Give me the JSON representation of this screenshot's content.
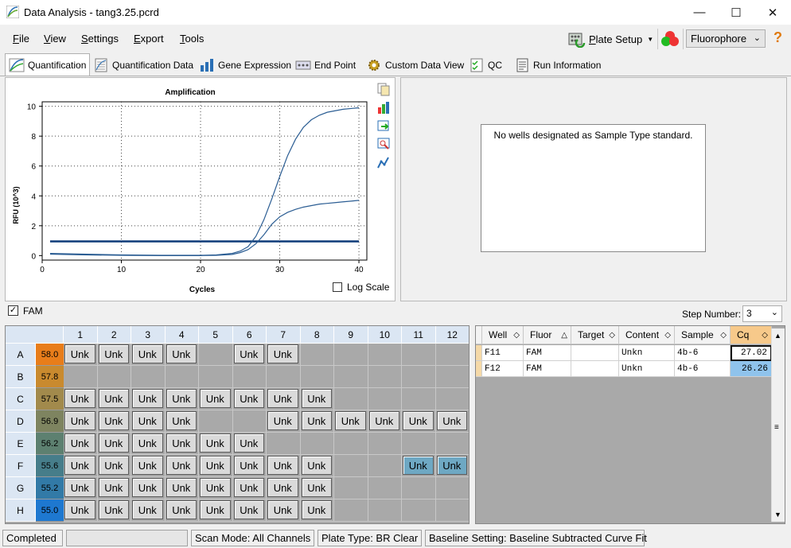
{
  "window": {
    "title": "Data Analysis - tang3.25.pcrd",
    "minimize": "—",
    "maximize": "☐",
    "close": "✕"
  },
  "menu": [
    {
      "label": "File",
      "key": "F",
      "rest": "ile"
    },
    {
      "label": "View",
      "key": "V",
      "rest": "iew"
    },
    {
      "label": "Settings",
      "key": "S",
      "rest": "ettings"
    },
    {
      "label": "Export",
      "key": "E",
      "rest": "xport"
    },
    {
      "label": "Tools",
      "key": "T",
      "rest": "ools"
    }
  ],
  "toolbar": {
    "plate_setup": "Plate Setup",
    "plate_setup_key": "P",
    "plate_setup_rest": "late Setup",
    "fluorophore": "Fluorophore",
    "help": "?"
  },
  "tabs": [
    "Quantification",
    "Quantification Data",
    "Gene Expression",
    "End Point",
    "Custom Data View",
    "QC",
    "Run Information"
  ],
  "chart_data": {
    "type": "line",
    "title": "Amplification",
    "xlabel": "Cycles",
    "ylabel": "RFU (10^3)",
    "xlim": [
      0,
      41
    ],
    "ylim": [
      -0.3,
      10.3
    ],
    "xticks": [
      0,
      10,
      20,
      30,
      40
    ],
    "yticks": [
      0,
      2,
      4,
      6,
      8,
      10
    ],
    "grid": true,
    "series": [
      {
        "x": [
          1,
          5,
          10,
          15,
          20,
          22,
          24,
          25,
          26,
          27,
          28,
          29,
          30,
          31,
          32,
          33,
          34,
          35,
          36,
          37,
          38,
          39,
          40
        ],
        "y": [
          0.15,
          0.1,
          0.05,
          0.02,
          0.02,
          0.05,
          0.15,
          0.3,
          0.6,
          1.3,
          2.4,
          3.8,
          5.3,
          6.7,
          7.8,
          8.6,
          9.1,
          9.4,
          9.6,
          9.7,
          9.8,
          9.85,
          9.9
        ]
      },
      {
        "x": [
          1,
          5,
          10,
          15,
          20,
          22,
          24,
          25,
          26,
          27,
          28,
          29,
          30,
          31,
          32,
          33,
          34,
          35,
          36,
          37,
          38,
          39,
          40
        ],
        "y": [
          0.1,
          0.05,
          0.02,
          0.0,
          0.0,
          0.02,
          0.08,
          0.2,
          0.4,
          0.8,
          1.4,
          2.1,
          2.6,
          2.9,
          3.1,
          3.25,
          3.35,
          3.45,
          3.5,
          3.55,
          3.6,
          3.65,
          3.7
        ]
      }
    ],
    "threshold": 0.95,
    "log_scale_label": "Log Scale"
  },
  "standard_message": "No wells designated as Sample Type standard.",
  "fam_label": "FAM",
  "step_number": {
    "label": "Step Number:",
    "value": "3"
  },
  "plate": {
    "columns": [
      "1",
      "2",
      "3",
      "4",
      "5",
      "6",
      "7",
      "8",
      "9",
      "10",
      "11",
      "12"
    ],
    "rows": [
      {
        "label": "A",
        "temp": "58.0",
        "color": "#e87d1a",
        "cells": [
          "Unk",
          "Unk",
          "Unk",
          "Unk",
          "",
          "Unk",
          "Unk",
          "",
          "",
          "",
          "",
          ""
        ]
      },
      {
        "label": "B",
        "temp": "57.8",
        "color": "#c98a2e",
        "cells": [
          "",
          "",
          "",
          "",
          "",
          "",
          "",
          "",
          "",
          "",
          "",
          ""
        ]
      },
      {
        "label": "C",
        "temp": "57.5",
        "color": "#a28a4c",
        "cells": [
          "Unk",
          "Unk",
          "Unk",
          "Unk",
          "Unk",
          "Unk",
          "Unk",
          "Unk",
          "",
          "",
          "",
          ""
        ]
      },
      {
        "label": "D",
        "temp": "56.9",
        "color": "#7e8460",
        "cells": [
          "Unk",
          "Unk",
          "Unk",
          "Unk",
          "",
          "",
          "Unk",
          "Unk",
          "Unk",
          "Unk",
          "Unk",
          "Unk"
        ]
      },
      {
        "label": "E",
        "temp": "56.2",
        "color": "#5d8070",
        "cells": [
          "Unk",
          "Unk",
          "Unk",
          "Unk",
          "Unk",
          "Unk",
          "",
          "",
          "",
          "",
          "",
          ""
        ]
      },
      {
        "label": "F",
        "temp": "55.6",
        "color": "#467d8a",
        "cells": [
          "Unk",
          "Unk",
          "Unk",
          "Unk",
          "Unk",
          "Unk",
          "Unk",
          "Unk",
          "",
          "",
          "Unk",
          "Unk"
        ]
      },
      {
        "label": "G",
        "temp": "55.2",
        "color": "#327aa7",
        "cells": [
          "Unk",
          "Unk",
          "Unk",
          "Unk",
          "Unk",
          "Unk",
          "Unk",
          "Unk",
          "",
          "",
          "",
          ""
        ]
      },
      {
        "label": "H",
        "temp": "55.0",
        "color": "#1e78d0",
        "cells": [
          "Unk",
          "Unk",
          "Unk",
          "Unk",
          "Unk",
          "Unk",
          "Unk",
          "Unk",
          "",
          "",
          "",
          ""
        ]
      }
    ],
    "selected": [
      "F11",
      "F12"
    ]
  },
  "table": {
    "headers": [
      "Well",
      "Fluor",
      "Target",
      "Content",
      "Sample",
      "Cq"
    ],
    "rows": [
      {
        "well": "F11",
        "fluor": "FAM",
        "target": "",
        "content": "Unkn",
        "sample": "4b-6",
        "cq": "27.02"
      },
      {
        "well": "F12",
        "fluor": "FAM",
        "target": "",
        "content": "Unkn",
        "sample": "4b-6",
        "cq": "26.26"
      }
    ]
  },
  "status": [
    "Completed",
    "",
    "Scan Mode: All Channels",
    "Plate Type: BR Clear",
    "Baseline Setting: Baseline Subtracted Curve Fit"
  ]
}
